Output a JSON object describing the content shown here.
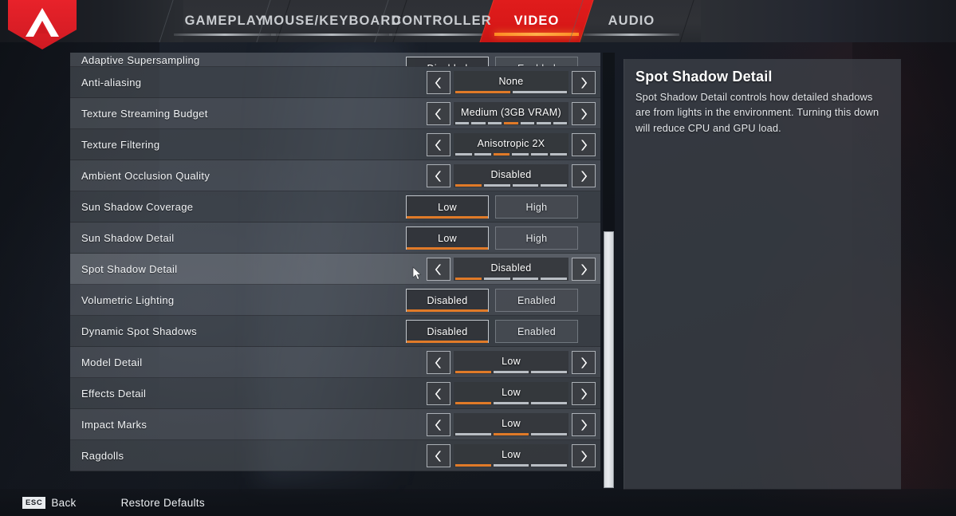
{
  "nav": {
    "logo_name": "apex-legends-logo",
    "tabs": [
      {
        "id": "gameplay",
        "label": "GAMEPLAY",
        "active": false
      },
      {
        "id": "mouse-keyboard",
        "label": "MOUSE/KEYBOARD",
        "active": false
      },
      {
        "id": "controller",
        "label": "CONTROLLER",
        "active": false
      },
      {
        "id": "video",
        "label": "VIDEO",
        "active": true
      },
      {
        "id": "audio",
        "label": "AUDIO",
        "active": false
      }
    ]
  },
  "settings": {
    "rows": [
      {
        "id": "adaptive-supersampling",
        "label": "Adaptive Supersampling",
        "type": "toggle",
        "clipped": true,
        "options": [
          "Disabled",
          "Enabled"
        ],
        "selected_index": 0
      },
      {
        "id": "anti-aliasing",
        "label": "Anti-aliasing",
        "type": "stepper",
        "value": "None",
        "steps": 2,
        "step_index": 0
      },
      {
        "id": "texture-streaming-budget",
        "label": "Texture Streaming Budget",
        "type": "stepper",
        "value": "Medium (3GB VRAM)",
        "steps": 7,
        "step_index": 3
      },
      {
        "id": "texture-filtering",
        "label": "Texture Filtering",
        "type": "stepper",
        "value": "Anisotropic 2X",
        "steps": 6,
        "step_index": 2
      },
      {
        "id": "ambient-occlusion-quality",
        "label": "Ambient Occlusion Quality",
        "type": "stepper",
        "value": "Disabled",
        "steps": 4,
        "step_index": 0
      },
      {
        "id": "sun-shadow-coverage",
        "label": "Sun Shadow Coverage",
        "type": "toggle",
        "options": [
          "Low",
          "High"
        ],
        "selected_index": 0
      },
      {
        "id": "sun-shadow-detail",
        "label": "Sun Shadow Detail",
        "type": "toggle",
        "options": [
          "Low",
          "High"
        ],
        "selected_index": 0
      },
      {
        "id": "spot-shadow-detail",
        "label": "Spot Shadow Detail",
        "type": "stepper",
        "value": "Disabled",
        "steps": 4,
        "step_index": 0,
        "selected": true
      },
      {
        "id": "volumetric-lighting",
        "label": "Volumetric Lighting",
        "type": "toggle",
        "options": [
          "Disabled",
          "Enabled"
        ],
        "selected_index": 0
      },
      {
        "id": "dynamic-spot-shadows",
        "label": "Dynamic Spot Shadows",
        "type": "toggle",
        "options": [
          "Disabled",
          "Enabled"
        ],
        "selected_index": 0
      },
      {
        "id": "model-detail",
        "label": "Model Detail",
        "type": "stepper",
        "value": "Low",
        "steps": 3,
        "step_index": 0
      },
      {
        "id": "effects-detail",
        "label": "Effects Detail",
        "type": "stepper",
        "value": "Low",
        "steps": 3,
        "step_index": 0
      },
      {
        "id": "impact-marks",
        "label": "Impact Marks",
        "type": "stepper",
        "value": "Low",
        "steps": 3,
        "step_index": 1
      },
      {
        "id": "ragdolls",
        "label": "Ragdolls",
        "type": "stepper",
        "value": "Low",
        "steps": 3,
        "step_index": 0
      }
    ],
    "prev_icon": "chevron-left-icon",
    "next_icon": "chevron-right-icon"
  },
  "description": {
    "title": "Spot Shadow Detail",
    "body": "Spot Shadow Detail controls how detailed shadows are from lights in the environment. Turning this down will reduce CPU and GPU load."
  },
  "footer": {
    "back_key": "ESC",
    "back_label": "Back",
    "restore_label": "Restore Defaults"
  },
  "colors": {
    "accent_orange": "#e07a28",
    "tab_active_red": "#d81818",
    "row_bg": "#6c7178",
    "row_selected_bg": "#8c929a",
    "panel_bg": "#40444b"
  }
}
